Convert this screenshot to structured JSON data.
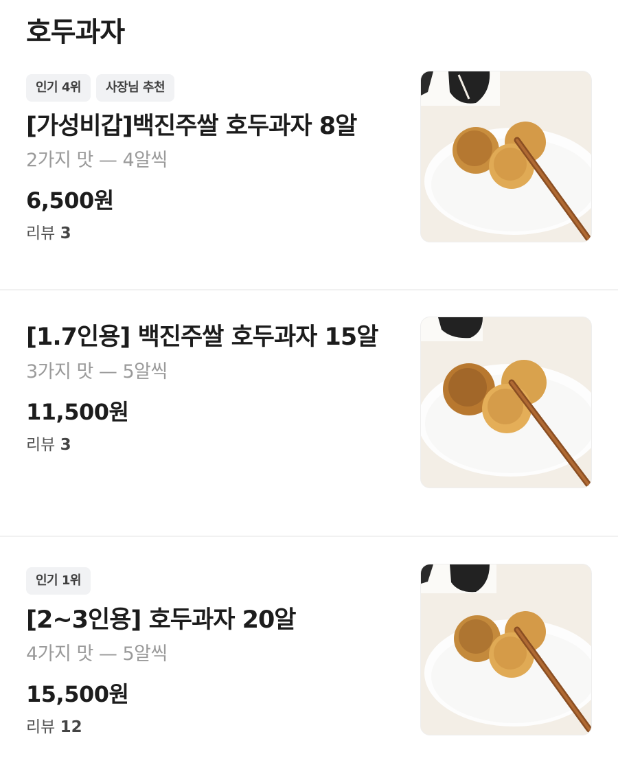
{
  "header": {
    "title": "호두과자"
  },
  "items": [
    {
      "badges": [
        "인기 4위",
        "사장님 추천"
      ],
      "name": "[가성비갑]백진주쌀 호두과자 8알",
      "option": "2가지 맛 — 4알씩",
      "price": "6,500원",
      "review_label": "리뷰",
      "review_count": "3",
      "image_icon": "walnut-cake-photo"
    },
    {
      "badges": [],
      "name": "[1.7인용] 백진주쌀 호두과자 15알",
      "option": "3가지 맛 — 5알씩",
      "price": "11,500원",
      "review_label": "리뷰",
      "review_count": "3",
      "image_icon": "walnut-cake-photo"
    },
    {
      "badges": [
        "인기 1위"
      ],
      "name": "[2~3인용] 호두과자 20알",
      "option": "4가지 맛 — 5알씩",
      "price": "15,500원",
      "review_label": "리뷰",
      "review_count": "12",
      "image_icon": "walnut-cake-photo"
    }
  ],
  "colors": {
    "badge_bg": "#f1f2f4",
    "option_text": "#9a9a9a",
    "divider": "#f1f1f1"
  }
}
